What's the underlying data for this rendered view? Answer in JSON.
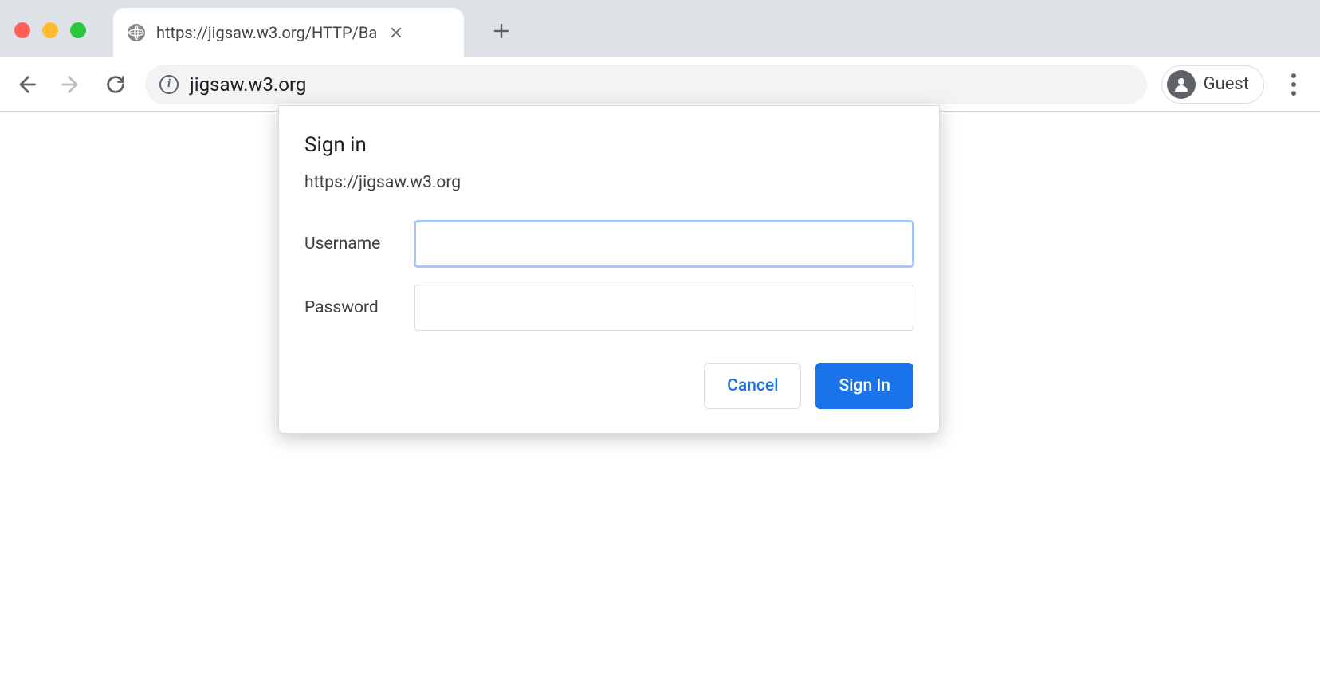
{
  "tab": {
    "title": "https://jigsaw.w3.org/HTTP/Ba"
  },
  "addressbar": {
    "display_url": "jigsaw.w3.org"
  },
  "profile": {
    "label": "Guest"
  },
  "auth_dialog": {
    "title": "Sign in",
    "origin": "https://jigsaw.w3.org",
    "username_label": "Username",
    "password_label": "Password",
    "username_value": "",
    "password_value": "",
    "cancel_label": "Cancel",
    "submit_label": "Sign In"
  }
}
